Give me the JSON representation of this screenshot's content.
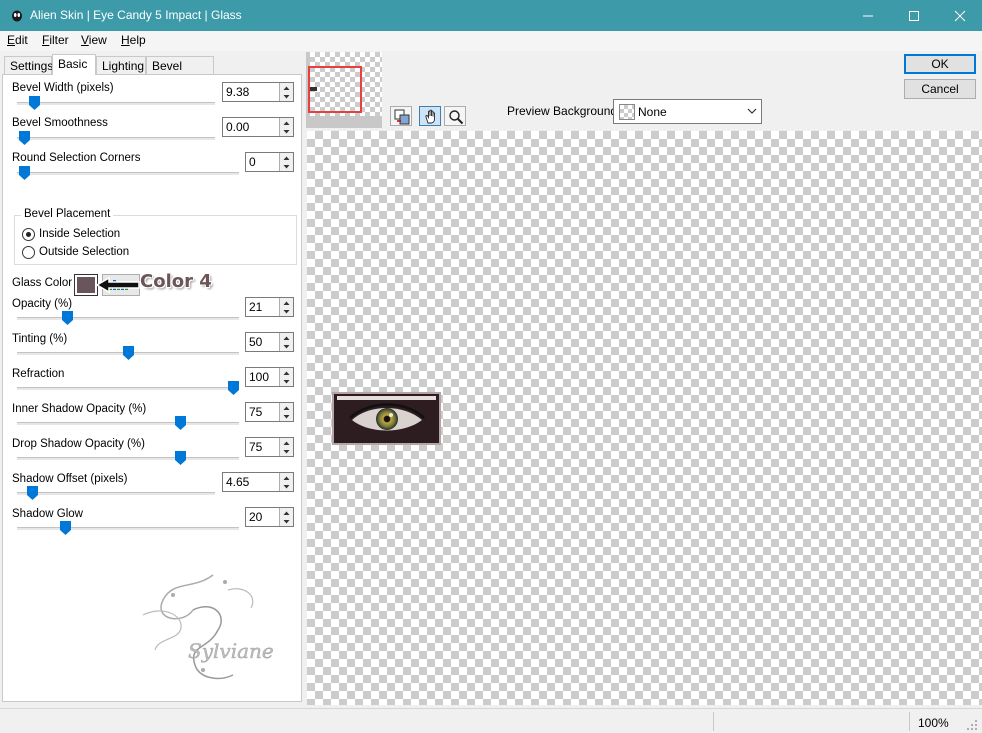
{
  "window": {
    "title": "Alien Skin | Eye Candy 5 Impact | Glass",
    "titlebar_color": "#3d9aa9"
  },
  "menu": [
    {
      "label": "Edit",
      "accel": "E",
      "rest": "dit"
    },
    {
      "label": "Filter",
      "accel": "F",
      "rest": "ilter"
    },
    {
      "label": "View",
      "accel": "V",
      "rest": "iew"
    },
    {
      "label": "Help",
      "accel": "H",
      "rest": "elp"
    }
  ],
  "tabs": [
    "Settings",
    "Basic",
    "Lighting",
    "Bevel Profile"
  ],
  "active_tab": "Basic",
  "controls": {
    "bevel_width": {
      "label": "Bevel Width (pixels)",
      "value": "9.38",
      "slider_fraction": 0.1
    },
    "bevel_smoothness": {
      "label": "Bevel Smoothness",
      "value": "0.00",
      "slider_fraction": 0.0
    },
    "round_corners": {
      "label": "Round Selection Corners",
      "value": "0",
      "slider_fraction": 0.0
    },
    "opacity": {
      "label": "Opacity (%)",
      "value": "21",
      "slider_fraction": 0.21
    },
    "tinting": {
      "label": "Tinting (%)",
      "value": "50",
      "slider_fraction": 0.5
    },
    "refraction": {
      "label": "Refraction",
      "value": "100",
      "slider_fraction": 1.0
    },
    "inner_shadow": {
      "label": "Inner Shadow Opacity (%)",
      "value": "75",
      "slider_fraction": 0.75
    },
    "drop_shadow": {
      "label": "Drop Shadow Opacity (%)",
      "value": "75",
      "slider_fraction": 0.75
    },
    "shadow_offset": {
      "label": "Shadow Offset (pixels)",
      "value": "4.65",
      "slider_fraction": 0.05
    },
    "shadow_glow": {
      "label": "Shadow Glow",
      "value": "20",
      "slider_fraction": 0.2
    }
  },
  "bevel_placement": {
    "title": "Bevel Placement",
    "options": [
      "Inside Selection",
      "Outside Selection"
    ],
    "selected": "Inside Selection"
  },
  "glass_color": {
    "label": "Glass Color",
    "color": "#6a555c",
    "annotation": "Color 4"
  },
  "watermark": {
    "text": "Sylviane"
  },
  "preview_background": {
    "label": "Preview Background:",
    "value": "None"
  },
  "buttons": {
    "ok": "OK",
    "cancel": "Cancel"
  },
  "status": {
    "zoom": "100%"
  },
  "accent_color": "#0078d7"
}
